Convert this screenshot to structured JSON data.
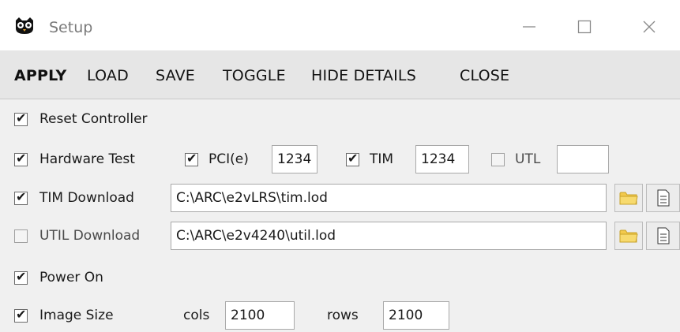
{
  "window": {
    "title": "Setup",
    "icon": "owl-icon"
  },
  "menu": {
    "apply": "APPLY",
    "load": "LOAD",
    "save": "SAVE",
    "toggle": "TOGGLE",
    "hide_details": "HIDE DETAILS",
    "close": "CLOSE"
  },
  "rows": {
    "reset_controller": {
      "label": "Reset Controller",
      "checked": true
    },
    "hardware_test": {
      "label": "Hardware Test",
      "checked": true,
      "pci": {
        "label": "PCI(e)",
        "checked": true,
        "value": "1234"
      },
      "tim": {
        "label": "TIM",
        "checked": true,
        "value": "1234"
      },
      "utl": {
        "label": "UTL",
        "checked": false,
        "value": ""
      }
    },
    "tim_download": {
      "label": "TIM Download",
      "checked": true,
      "path": "C:\\ARC\\e2vLRS\\tim.lod"
    },
    "util_download": {
      "label": "UTIL Download",
      "checked": false,
      "path": "C:\\ARC\\e2v4240\\util.lod"
    },
    "power_on": {
      "label": "Power On",
      "checked": true
    },
    "image_size": {
      "label": "Image Size",
      "checked": true,
      "cols_label": "cols",
      "cols": "2100",
      "rows_label": "rows",
      "rows": "2100"
    }
  },
  "colors": {
    "folder": "#f2c94c",
    "folder_dark": "#c9a227",
    "accent": "#1a1a1a"
  }
}
